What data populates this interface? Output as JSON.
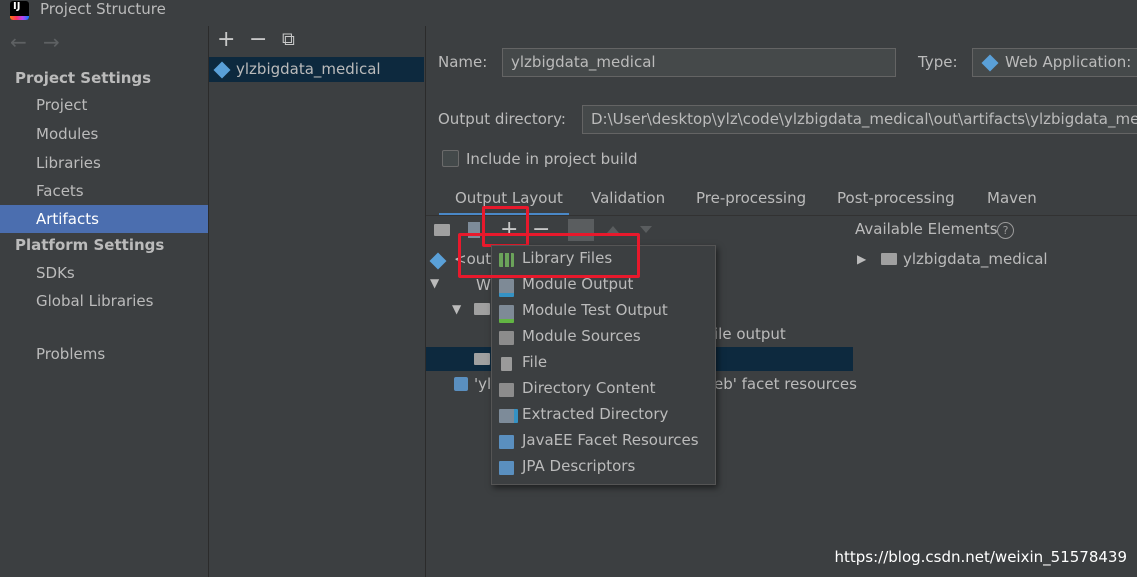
{
  "window": {
    "title": "Project Structure"
  },
  "nav": {
    "back": "←",
    "forward": "→",
    "project_settings_header": "Project Settings",
    "project_settings": [
      "Project",
      "Modules",
      "Libraries",
      "Facets",
      "Artifacts"
    ],
    "platform_settings_header": "Platform Settings",
    "platform_settings": [
      "SDKs",
      "Global Libraries"
    ],
    "problems": "Problems"
  },
  "artifacts_toolbar": {
    "add": "+",
    "remove": "−",
    "copy": "⧉"
  },
  "artifacts": [
    "ylzbigdata_medical"
  ],
  "form": {
    "name_label": "Name:",
    "name_value": "ylzbigdata_medical",
    "type_label": "Type:",
    "type_value": "Web Application: E",
    "output_dir_label": "Output directory:",
    "output_dir_value": "D:\\User\\desktop\\ylz\\code\\ylzbigdata_medical\\out\\artifacts\\ylzbigdata_medical",
    "include_label": "Include in project build"
  },
  "tabs": [
    "Output Layout",
    "Validation",
    "Pre-processing",
    "Post-processing",
    "Maven"
  ],
  "layout_toolbar": {
    "add": "+",
    "remove": "−"
  },
  "tree": {
    "root_partial": "<outp",
    "web_partial": "W",
    "row4_partial": "ile output",
    "row6_prefix": "'yl",
    "row6_suffix": "eb' facet resources"
  },
  "available": {
    "title": "Available Elements",
    "help": "?",
    "items": [
      "ylzbigdata_medical"
    ]
  },
  "add_menu": {
    "items": [
      "Library Files",
      "Module Output",
      "Module Test Output",
      "Module Sources",
      "File",
      "Directory Content",
      "Extracted Directory",
      "JavaEE Facet Resources",
      "JPA Descriptors"
    ]
  },
  "watermark": "https://blog.csdn.net/weixin_51578439",
  "colors": {
    "selection": "#4b6eaf",
    "highlight": "#e8192c",
    "accent": "#4a88c7"
  }
}
